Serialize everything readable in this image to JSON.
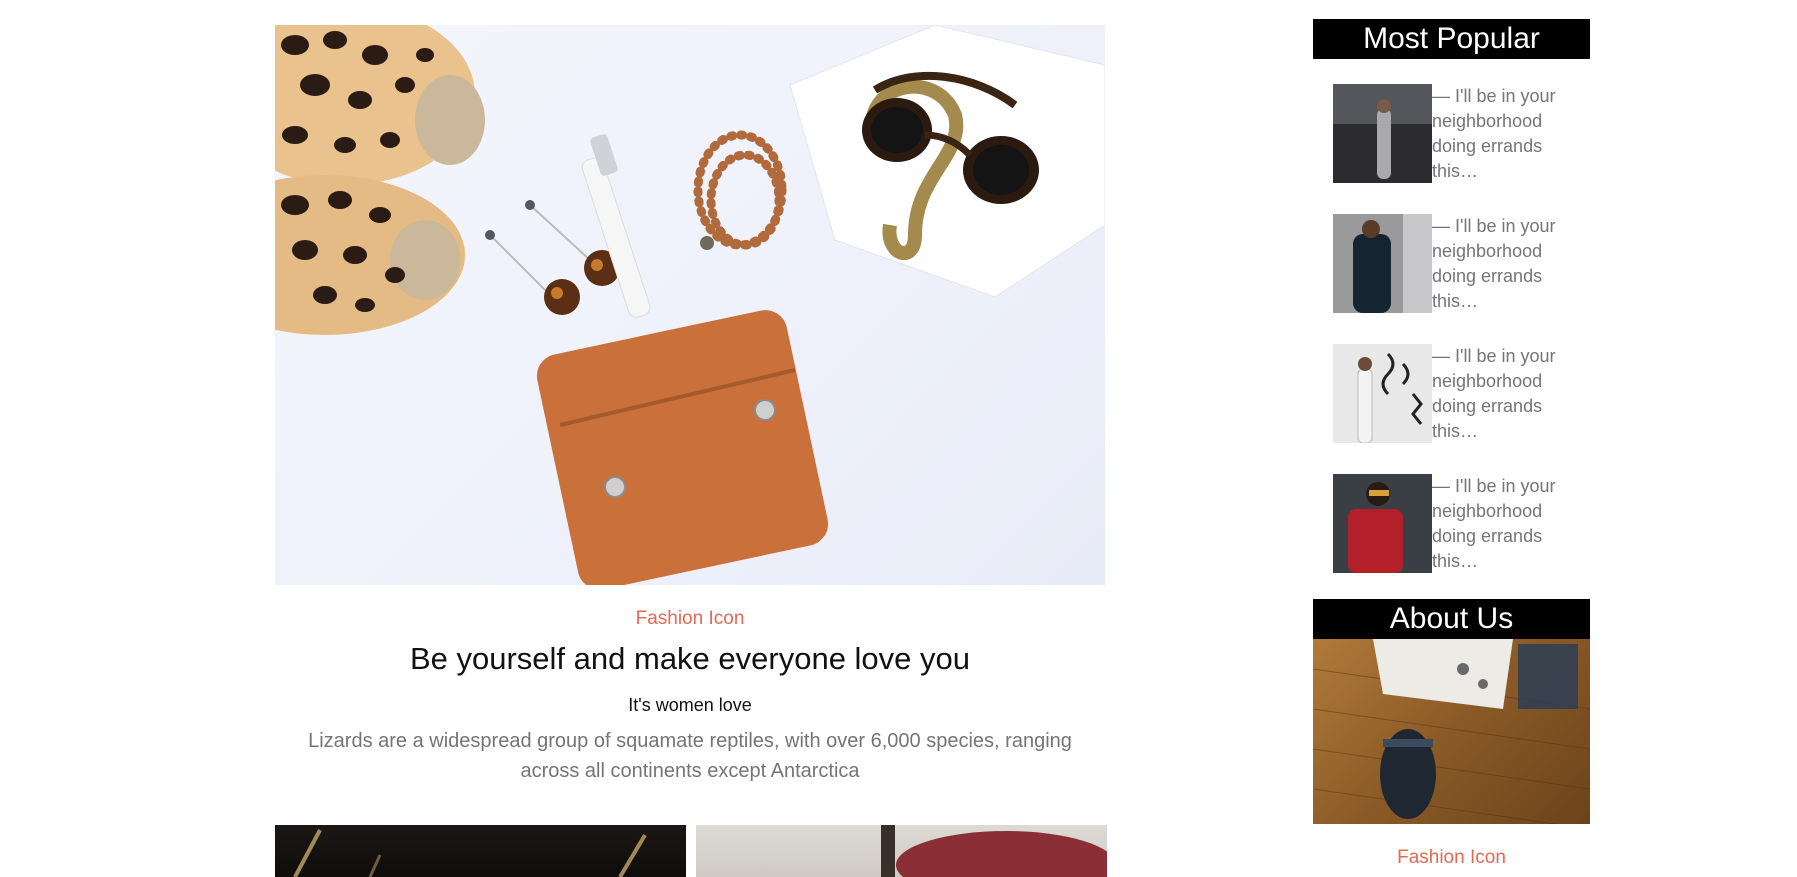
{
  "main": {
    "featured": {
      "category": "Fashion Icon",
      "title": "Be yourself and make everyone love you",
      "subtitle": "It's women love",
      "excerpt": "Lizards are a widespread group of squamate reptiles, with over 6,000 species, ranging across all continents except Antarctica"
    }
  },
  "sidebar": {
    "most_popular": {
      "title": "Most Popular",
      "items": [
        {
          "text": "— I'll be in your neighborhood doing errands this…"
        },
        {
          "text": "— I'll be in your neighborhood doing errands this…"
        },
        {
          "text": "— I'll be in your neighborhood doing errands this…"
        },
        {
          "text": "— I'll be in your neighborhood doing errands this…"
        }
      ]
    },
    "about": {
      "title": "About Us",
      "category": "Fashion Icon"
    }
  },
  "colors": {
    "accent": "#e06a55",
    "widget_header_bg": "#000000",
    "body_text": "#757575"
  }
}
